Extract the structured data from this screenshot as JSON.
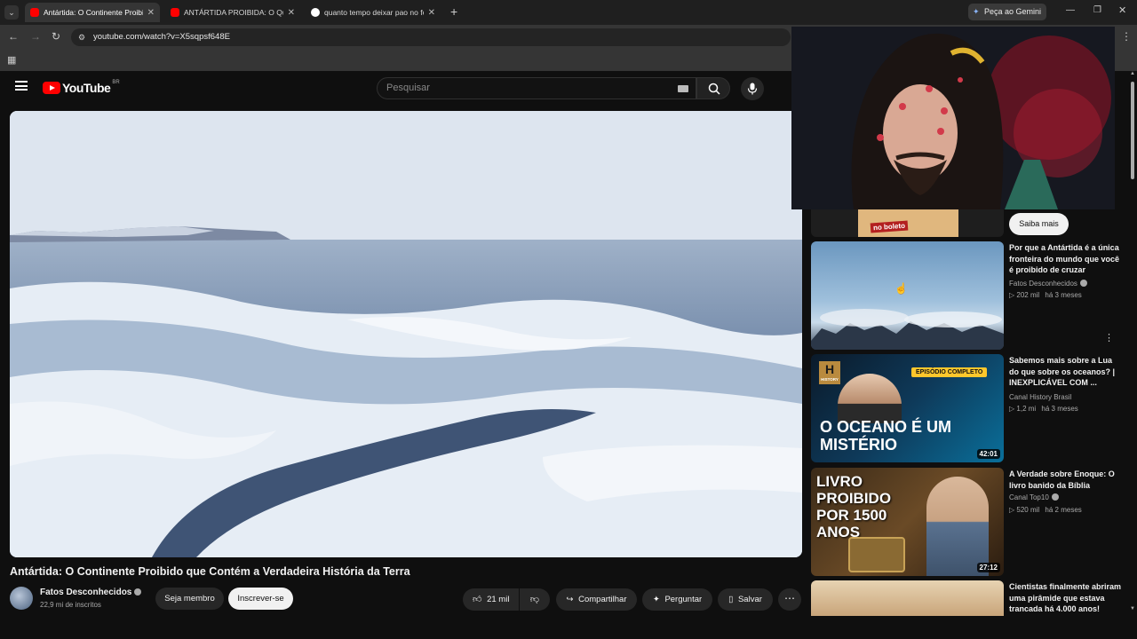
{
  "browser": {
    "tabs": [
      {
        "title": "Antártida: O Continente Proibido",
        "active": true,
        "favicon": "youtube"
      },
      {
        "title": "ANTÁRTIDA PROIBIDA: O Que",
        "active": false,
        "favicon": "youtube"
      },
      {
        "title": "quanto tempo deixar pao no fo",
        "active": false,
        "favicon": "google"
      }
    ],
    "new_tab": "+",
    "gemini_label": "Peça ao Gemini",
    "url": "youtube.com/watch?v=X5sqpsf648E"
  },
  "youtube": {
    "logo_text": "YouTube",
    "region": "BR",
    "search_placeholder": "Pesquisar"
  },
  "video": {
    "title": "Antártida: O Continente Proibido que Contém a Verdadeira História da Terra",
    "channel": "Fatos Desconhecidos",
    "subscribers": "22,9 mi de inscritos",
    "join_label": "Seja membro",
    "subscribe_label": "Inscrever-se",
    "likes": "21 mil",
    "share_label": "Compartilhar",
    "ask_label": "Perguntar",
    "save_label": "Salvar"
  },
  "ad": {
    "banner_text": "no boleto",
    "cta": "Saiba mais"
  },
  "related": [
    {
      "title": "Por que a Antártida é a única fronteira do mundo que você é proibido de cruzar",
      "channel": "Fatos Desconhecidos",
      "views": "202 mil",
      "age": "há 3 meses",
      "duration": ""
    },
    {
      "title": "Sabemos mais sobre a Lua do que sobre os oceanos? | INEXPLICÁVEL COM ...",
      "channel": "Canal History Brasil",
      "views": "1,2 mi",
      "age": "há 3 meses",
      "duration": "42:01",
      "thumb_badge": "EPISÓDIO COMPLETO",
      "thumb_text": "O OCEANO É UM MISTÉRIO",
      "thumb_logo": "HISTORY"
    },
    {
      "title": "A Verdade sobre Enoque: O livro banido da Bíblia",
      "channel": "Canal Top10",
      "views": "520 mil",
      "age": "há 2 meses",
      "duration": "27:12",
      "thumb_text": "LIVRO PROIBIDO POR 1500 ANOS"
    },
    {
      "title": "Cientistas finalmente abriram uma pirâmide que estava trancada há 4.000 anos!",
      "channel": "",
      "views": "",
      "age": "",
      "duration": ""
    }
  ]
}
